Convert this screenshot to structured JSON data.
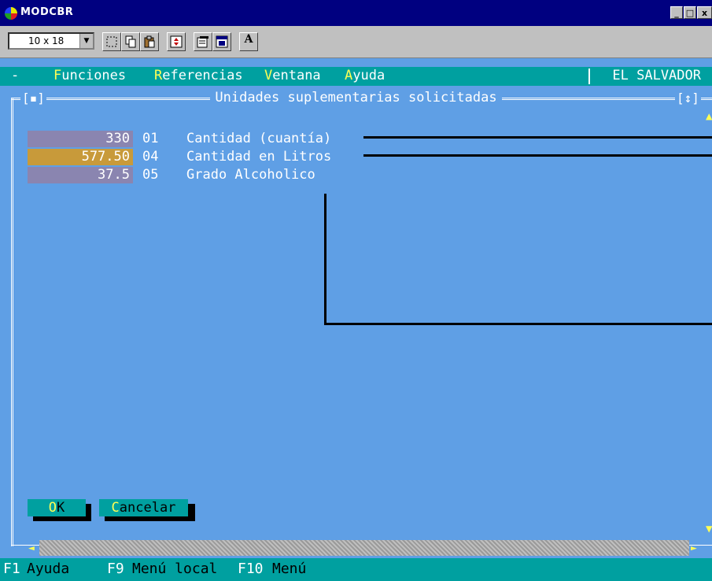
{
  "window": {
    "title": "MODCBR",
    "controls": [
      "_",
      "□",
      "x"
    ]
  },
  "toolbar": {
    "font_size": "10 x 18"
  },
  "menubar": {
    "system": "-",
    "items": [
      {
        "hot": "F",
        "rest": "unciones"
      },
      {
        "hot": "R",
        "rest": "eferencias"
      },
      {
        "hot": "V",
        "rest": "entana"
      },
      {
        "hot": "A",
        "rest": "yuda"
      }
    ],
    "country": "EL SALVADOR"
  },
  "dialog": {
    "title": "Unidades suplementarias solicitadas",
    "close_box": "[▪]",
    "resize_box": "[↕]",
    "rows": [
      {
        "value": "330",
        "code": "01",
        "label": "Cantidad (cuantía)",
        "color": "#8a85b0"
      },
      {
        "value": "577.50",
        "code": "04",
        "label": "Cantidad en Litros",
        "color": "#c89a3a"
      },
      {
        "value": "37.5",
        "code": "05",
        "label": "Grado Alcoholico",
        "color": "#8a85b0"
      }
    ],
    "ok": {
      "hot": "O",
      "rest": "K"
    },
    "cancel": {
      "hot": "C",
      "rest": "ancelar"
    }
  },
  "statusbar": [
    {
      "key": "F1",
      "label": "Ayuda"
    },
    {
      "key": "F9",
      "label": "Menú local"
    },
    {
      "key": "F10",
      "label": "Menú"
    }
  ],
  "colors": {
    "background": "#5f9fe5",
    "teal": "#00a0a0",
    "titlebar": "#000080"
  }
}
